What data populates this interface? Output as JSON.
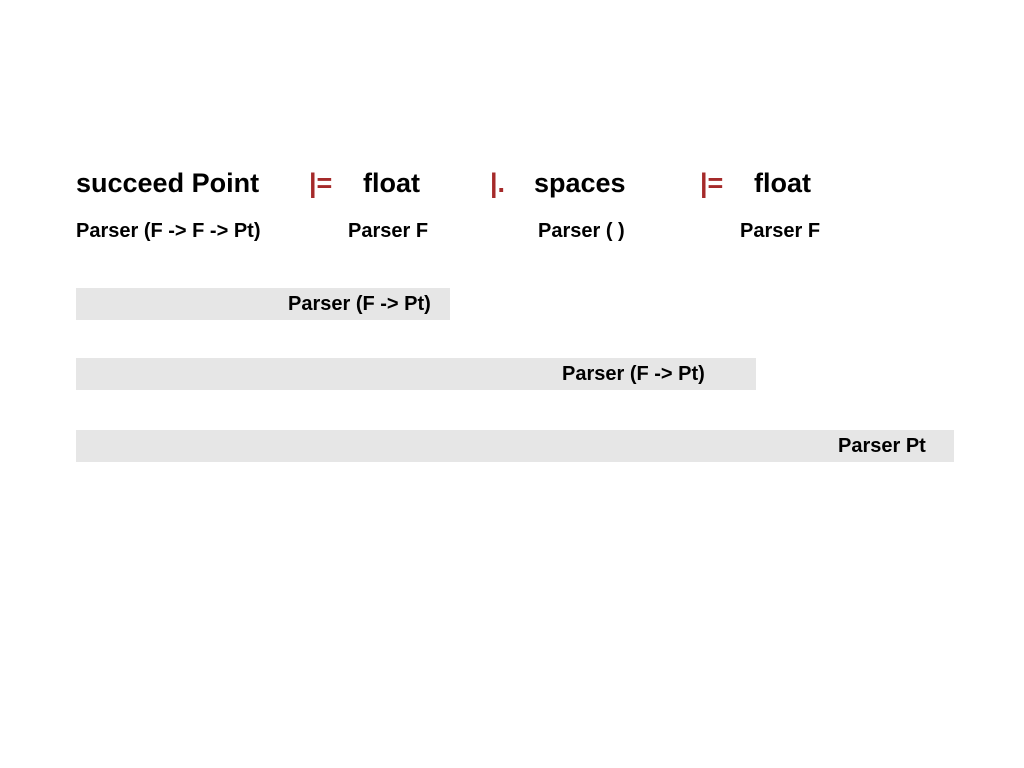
{
  "expr": {
    "e1": "succeed Point",
    "op1": "|=",
    "e2": "float",
    "op2": "|.",
    "e3": "spaces",
    "op3": "|=",
    "e4": "float"
  },
  "types": {
    "t1": "Parser (F -> F -> Pt)",
    "t2": "Parser F",
    "t3": "Parser ( )",
    "t4": "Parser F"
  },
  "bars": {
    "b1": "Parser (F -> Pt)",
    "b2": "Parser (F -> Pt)",
    "b3": "Parser Pt"
  }
}
